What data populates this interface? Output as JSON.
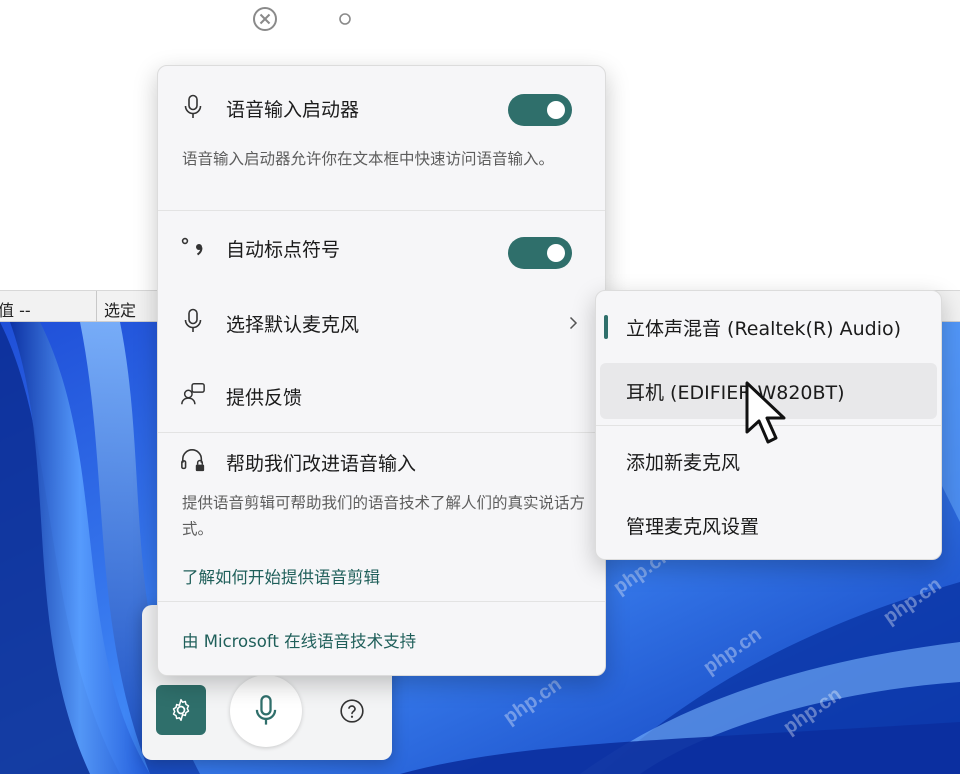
{
  "top_toolbar": {
    "close_icon": "close-circle-icon",
    "dot_icon": "dot-icon"
  },
  "status_strip": {
    "left_label": "值  --",
    "mid_label": "选定"
  },
  "watermark_text": "php.cn",
  "settings_panel": {
    "voice_launcher": {
      "icon": "microphone-icon",
      "label": "语音输入启动器",
      "toggle_on": true,
      "description": "语音输入启动器允许你在文本框中快速访问语音输入。"
    },
    "auto_punctuation": {
      "icon": "punctuation-icon",
      "label": "自动标点符号",
      "toggle_on": true
    },
    "default_mic": {
      "icon": "microphone-icon",
      "label": "选择默认麦克风",
      "chevron_icon": "chevron-right-icon"
    },
    "feedback": {
      "icon": "feedback-icon",
      "label": "提供反馈"
    },
    "improve_voice": {
      "icon": "headset-lock-icon",
      "label": "帮助我们改进语音输入",
      "description": "提供语音剪辑可帮助我们的语音技术了解人们的真实说话方式。",
      "link": "了解如何开始提供语音剪辑"
    },
    "footer_link": "由 Microsoft 在线语音技术支持"
  },
  "mic_submenu": {
    "items": [
      {
        "label": "立体声混音 (Realtek(R) Audio)",
        "selected": true
      },
      {
        "label": "耳机 (EDIFIER W820BT)",
        "hovered": true
      },
      {
        "label": "添加新麦克风"
      },
      {
        "label": "管理麦克风设置"
      }
    ]
  },
  "voice_bar": {
    "settings_icon": "gear-icon",
    "mic_icon": "microphone-icon",
    "help_icon": "help-circle-icon"
  },
  "colors": {
    "accent": "#2f6f6b",
    "panel_bg": "#f6f6f8",
    "desktop_blue": "#2f6fe6"
  }
}
